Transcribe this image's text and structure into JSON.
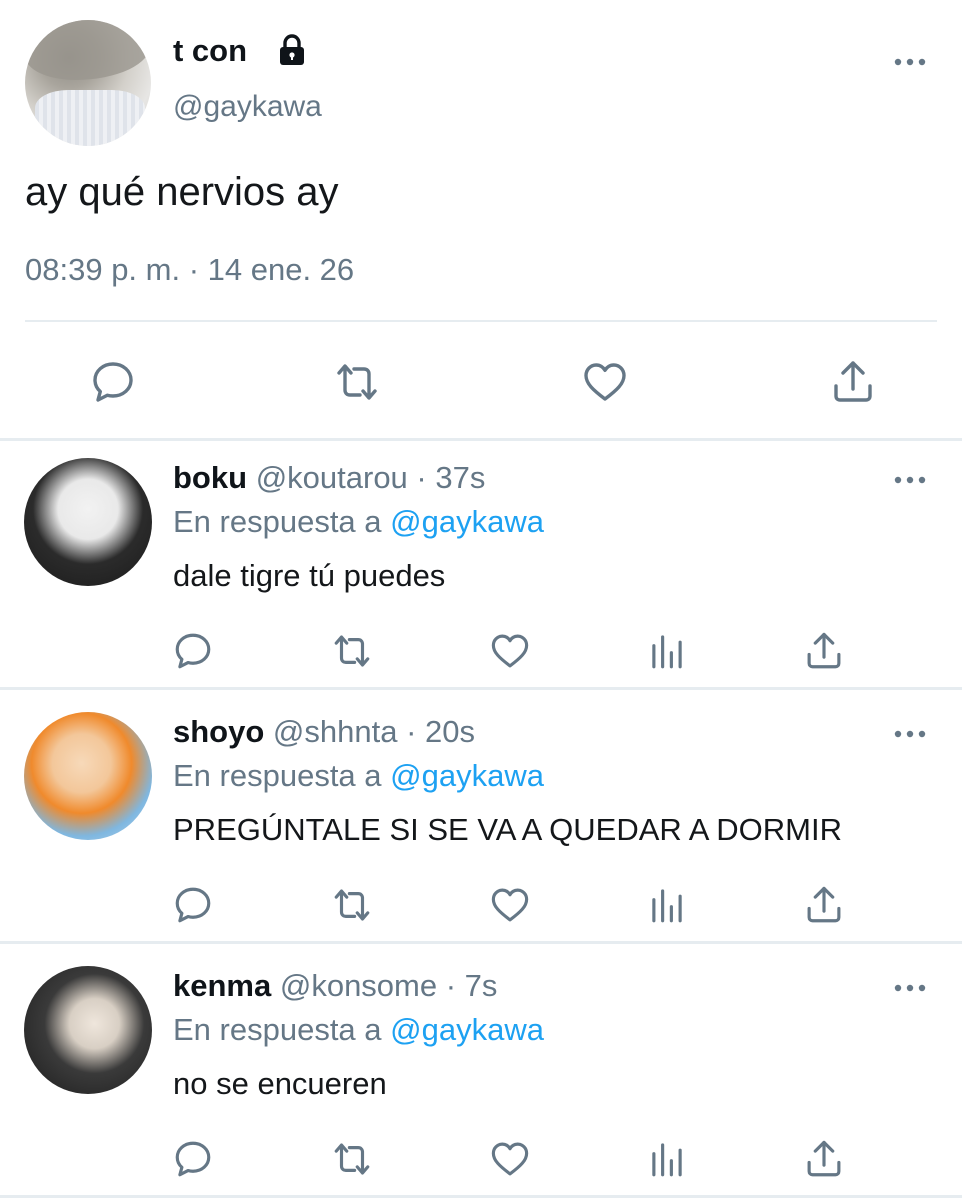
{
  "main_tweet": {
    "display_name": "t con",
    "handle": "@gaykawa",
    "text": "ay qué nervios ay",
    "timestamp": "08:39 p. m. · 14 ene. 26",
    "avatar_icon": "profile-photo",
    "lock_icon": "lock-icon",
    "actions": [
      "reply-icon",
      "retweet-icon",
      "like-icon",
      "share-icon"
    ]
  },
  "replies": [
    {
      "display_name": "boku",
      "handle": "@koutarou",
      "time": "· 37s",
      "reply_prefix": "En respuesta a",
      "reply_to": "@gaykawa",
      "text": "dale tigre tú puedes"
    },
    {
      "display_name": "shoyo",
      "handle": "@shhnta",
      "time": "· 20s",
      "reply_prefix": "En respuesta a",
      "reply_to": "@gaykawa",
      "text": "PREGÚNTALE SI SE VA A QUEDAR A DORMIR"
    },
    {
      "display_name": "kenma",
      "handle": "@konsome",
      "time": "· 7s",
      "reply_prefix": "En respuesta a",
      "reply_to": "@gaykawa",
      "text": "no se encueren"
    }
  ],
  "colors": {
    "text": "#0f1419",
    "secondary": "#657786",
    "link": "#1da1f2",
    "divider": "#e6ecf0"
  }
}
